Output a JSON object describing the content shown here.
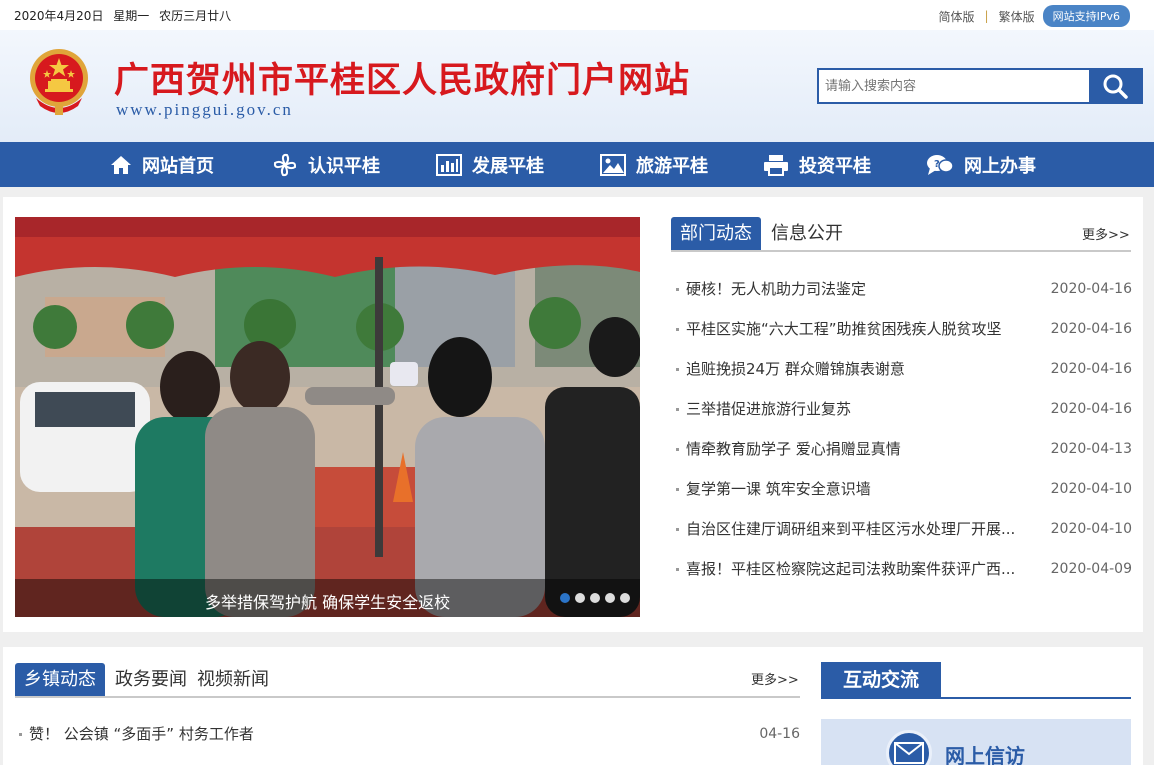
{
  "topbar": {
    "date": "2020年4月20日",
    "weekday": "星期一",
    "lunar": "农历三月廿八",
    "simplified": "简体版",
    "separator": "|",
    "traditional": "繁体版",
    "ipv6": "网站支持IPv6"
  },
  "header": {
    "title": "广西贺州市平桂区人民政府门户网站",
    "url": "www.pinggui.gov.cn",
    "search_placeholder": "请输入搜索内容"
  },
  "nav": [
    {
      "label": "网站首页",
      "icon": "home-icon"
    },
    {
      "label": "认识平桂",
      "icon": "pinwheel-icon"
    },
    {
      "label": "发展平桂",
      "icon": "bar-chart-icon"
    },
    {
      "label": "旅游平桂",
      "icon": "picture-icon"
    },
    {
      "label": "投资平桂",
      "icon": "printer-icon"
    },
    {
      "label": "网上办事",
      "icon": "chat-icon"
    }
  ],
  "slider": {
    "caption": "多举措保驾护航 确保学生安全返校",
    "dots": 5,
    "active_dot": 0
  },
  "dept": {
    "tabs": [
      "部门动态",
      "信息公开"
    ],
    "more": "更多>>",
    "items": [
      {
        "title": "硬核！无人机助力司法鉴定",
        "date": "2020-04-16"
      },
      {
        "title": "平桂区实施“六大工程”助推贫困残疾人脱贫攻坚",
        "date": "2020-04-16"
      },
      {
        "title": "追赃挽损24万 群众赠锦旗表谢意",
        "date": "2020-04-16"
      },
      {
        "title": "三举措促进旅游行业复苏",
        "date": "2020-04-16"
      },
      {
        "title": "情牵教育励学子 爱心捐赠显真情",
        "date": "2020-04-13"
      },
      {
        "title": "复学第一课 筑牢安全意识墙",
        "date": "2020-04-10"
      },
      {
        "title": "自治区住建厅调研组来到平桂区污水处理厂开展...",
        "date": "2020-04-10"
      },
      {
        "title": "喜报！平桂区检察院这起司法救助案件获评广西...",
        "date": "2020-04-09"
      }
    ]
  },
  "town": {
    "tabs": [
      "乡镇动态",
      "政务要闻",
      "视频新闻"
    ],
    "more": "更多>>",
    "items": [
      {
        "title": "赞！ 公会镇 “多面手” 村务工作者",
        "date": "04-16"
      }
    ]
  },
  "interact": {
    "title": "互动交流",
    "letter": "网上信访"
  },
  "colors": {
    "brand_blue": "#2b5ca7",
    "title_red": "#d7191e"
  }
}
